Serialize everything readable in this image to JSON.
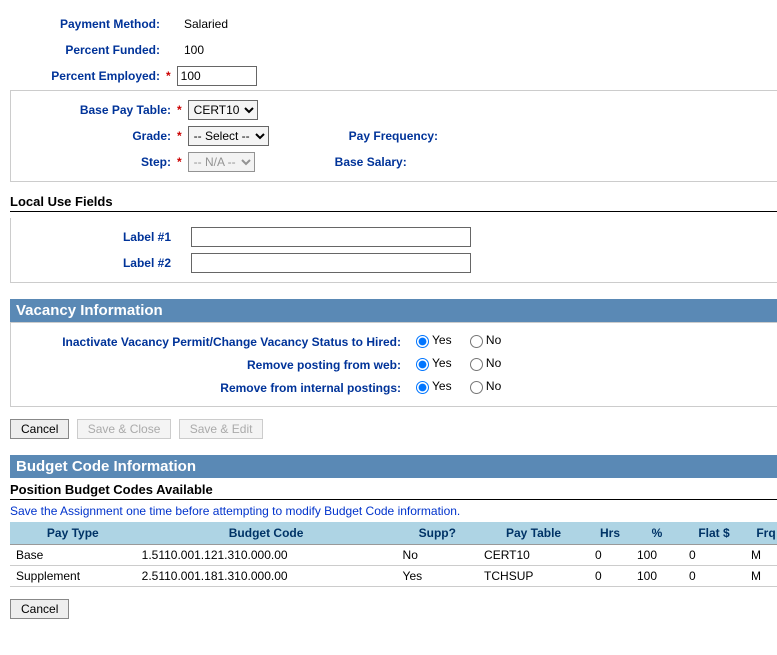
{
  "payment": {
    "method_label": "Payment Method:",
    "method_value": "Salaried",
    "percent_funded_label": "Percent Funded:",
    "percent_funded_value": "100",
    "percent_employed_label": "Percent Employed:",
    "percent_employed_value": "100"
  },
  "pay": {
    "base_pay_table_label": "Base Pay Table:",
    "base_pay_table_value": "CERT10",
    "grade_label": "Grade:",
    "grade_value": "-- Select --",
    "step_label": "Step:",
    "step_value": "-- N/A --",
    "pay_frequency_label": "Pay Frequency:",
    "base_salary_label": "Base Salary:"
  },
  "local": {
    "title": "Local Use Fields",
    "label1": "Label #1",
    "label2": "Label #2",
    "value1": "",
    "value2": ""
  },
  "vacancy": {
    "title": "Vacancy Information",
    "q1": "Inactivate Vacancy Permit/Change Vacancy Status to Hired:",
    "q2": "Remove posting from web:",
    "q3": "Remove from internal postings:",
    "yes": "Yes",
    "no": "No"
  },
  "buttons": {
    "cancel": "Cancel",
    "save_close": "Save & Close",
    "save_edit": "Save & Edit"
  },
  "budget": {
    "title": "Budget Code Information",
    "subtitle": "Position Budget Codes Available",
    "hint": "Save the Assignment one time before attempting to modify Budget Code information.",
    "headers": {
      "pay_type": "Pay Type",
      "budget_code": "Budget Code",
      "supp": "Supp?",
      "pay_table": "Pay Table",
      "hrs": "Hrs",
      "pct": "%",
      "flat": "Flat $",
      "frq": "Frq"
    },
    "rows": [
      {
        "pay_type": "Base",
        "budget_code": "1.5110.001.121.310.000.00",
        "supp": "No",
        "pay_table": "CERT10",
        "hrs": "0",
        "pct": "100",
        "flat": "0",
        "frq": "M"
      },
      {
        "pay_type": "Supplement",
        "budget_code": "2.5110.001.181.310.000.00",
        "supp": "Yes",
        "pay_table": "TCHSUP",
        "hrs": "0",
        "pct": "100",
        "flat": "0",
        "frq": "M"
      }
    ]
  },
  "bottom": {
    "cancel": "Cancel"
  }
}
